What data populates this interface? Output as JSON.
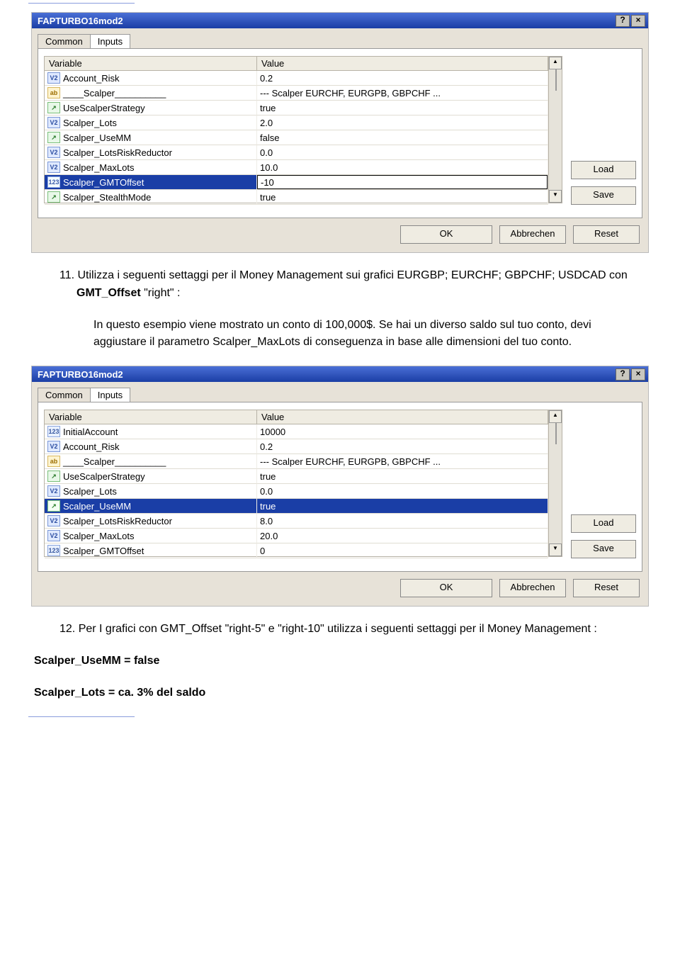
{
  "dlg1": {
    "title": "FAPTURBO16mod2",
    "tabs": [
      "Common",
      "Inputs"
    ],
    "headers": {
      "var": "Variable",
      "val": "Value"
    },
    "rows": [
      {
        "icon": "v2",
        "name": "Account_Risk",
        "value": "0.2"
      },
      {
        "icon": "ab",
        "name": "____Scalper__________",
        "value": "--- Scalper EURCHF, EURGPB, GBPCHF ..."
      },
      {
        "icon": "zs",
        "name": "UseScalperStrategy",
        "value": "true"
      },
      {
        "icon": "v2",
        "name": "Scalper_Lots",
        "value": "2.0"
      },
      {
        "icon": "zs",
        "name": "Scalper_UseMM",
        "value": "false"
      },
      {
        "icon": "v2",
        "name": "Scalper_LotsRiskReductor",
        "value": "0.0"
      },
      {
        "icon": "v2",
        "name": "Scalper_MaxLots",
        "value": "10.0"
      },
      {
        "icon": "i123",
        "name": "Scalper_GMTOffset",
        "value": "-10",
        "selected": true,
        "edit": true
      },
      {
        "icon": "zs",
        "name": "Scalper_StealthMode",
        "value": "true"
      }
    ],
    "buttons": {
      "load": "Load",
      "save": "Save",
      "ok": "OK",
      "cancel": "Abbrechen",
      "reset": "Reset"
    }
  },
  "dlg2": {
    "title": "FAPTURBO16mod2",
    "tabs": [
      "Common",
      "Inputs"
    ],
    "headers": {
      "var": "Variable",
      "val": "Value"
    },
    "rows": [
      {
        "icon": "i123",
        "name": "InitialAccount",
        "value": "10000"
      },
      {
        "icon": "v2",
        "name": "Account_Risk",
        "value": "0.2"
      },
      {
        "icon": "ab",
        "name": "____Scalper__________",
        "value": "--- Scalper EURCHF, EURGPB, GBPCHF ..."
      },
      {
        "icon": "zs",
        "name": "UseScalperStrategy",
        "value": "true"
      },
      {
        "icon": "v2",
        "name": "Scalper_Lots",
        "value": "0.0"
      },
      {
        "icon": "zs",
        "name": "Scalper_UseMM",
        "value": "true",
        "selected": true
      },
      {
        "icon": "v2",
        "name": "Scalper_LotsRiskReductor",
        "value": "8.0"
      },
      {
        "icon": "v2",
        "name": "Scalper_MaxLots",
        "value": "20.0"
      },
      {
        "icon": "i123",
        "name": "Scalper_GMTOffset",
        "value": "0"
      }
    ],
    "buttons": {
      "load": "Load",
      "save": "Save",
      "ok": "OK",
      "cancel": "Abbrechen",
      "reset": "Reset"
    }
  },
  "text": {
    "p11a": "11. Utilizza i seguenti settaggi per il Money Management sui grafici EURGBP; EURCHF; GBPCHF; USDCAD con ",
    "p11b": "GMT_Offset",
    "p11c": " \"right\" :",
    "p11d": "In questo esempio viene mostrato un conto di 100,000$. Se hai un diverso saldo sul tuo conto, devi aggiustare il parametro    Scalper_MaxLots di conseguenza in base alle dimensioni del tuo conto.",
    "p12a": "12. Per I grafici con GMT_Offset    \"right-5\"  e    \"right-10\" utilizza i seguenti settaggi per il Money Management :",
    "s1": "Scalper_UseMM = false",
    "s2": "Scalper_Lots = ca. 3% del saldo"
  }
}
